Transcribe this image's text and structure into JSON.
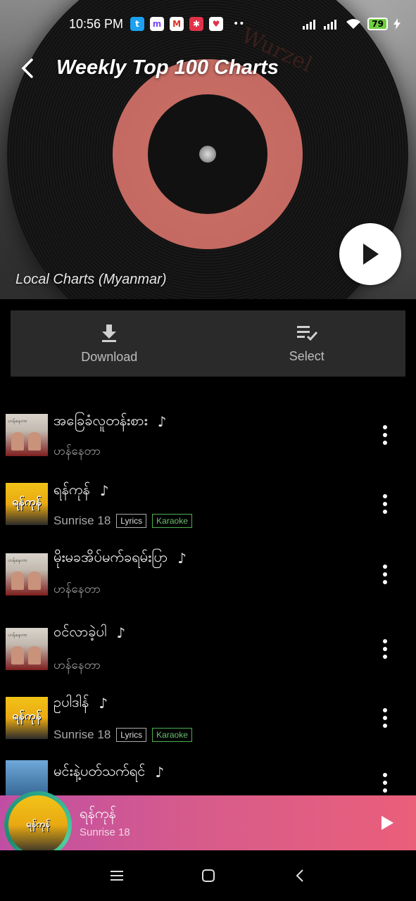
{
  "status_bar": {
    "time": "10:56 PM",
    "notifications": [
      "twitter-icon",
      "messenger-icon",
      "gmail-icon",
      "app-icon",
      "app-heart-icon"
    ],
    "more": "••",
    "battery": "79"
  },
  "header": {
    "title": "Weekly Top 100 Charts",
    "subtitle": "Local Charts (Myanmar)",
    "record_label_text": "Wurzel"
  },
  "actions": {
    "download_label": "Download",
    "select_label": "Select"
  },
  "songs": [
    {
      "title": "အခြေခံလူတန်းစား",
      "artist": "ဟန်နေတာ",
      "thumb": "t1",
      "tags": []
    },
    {
      "title": "ရန်ကုန်",
      "artist": "Sunrise 18",
      "thumb": "t2",
      "tags": [
        "Lyrics",
        "Karaoke"
      ]
    },
    {
      "title": "မိုးမခအိပ်မက်ခရမ်းပြာ",
      "artist": "ဟန်နေတာ",
      "thumb": "t1",
      "tags": []
    },
    {
      "title": "ဝင်လာခဲ့ပါ",
      "artist": "ဟန်နေတာ",
      "thumb": "t1",
      "tags": []
    },
    {
      "title": "ဥပါဒါန်",
      "artist": "Sunrise 18",
      "thumb": "t2",
      "tags": [
        "Lyrics",
        "Karaoke"
      ]
    },
    {
      "title": "မင်းနဲ့ပတ်သက်ရင်",
      "artist": "",
      "thumb": "t3",
      "tags": []
    }
  ],
  "thumb_text": {
    "t1_caption": "ဟန်နေတာ",
    "t2_caption": "ရန်ကုန်"
  },
  "mini_player": {
    "title": "ရန်ကုန်",
    "artist": "Sunrise 18",
    "art_text": "ရန်ကုန်"
  },
  "colors": {
    "mini_player_start": "#c04fa3",
    "mini_player_end": "#ea5f7a",
    "karaoke_tag": "#4caf50",
    "action_bar_bg": "#2a2a2a"
  }
}
